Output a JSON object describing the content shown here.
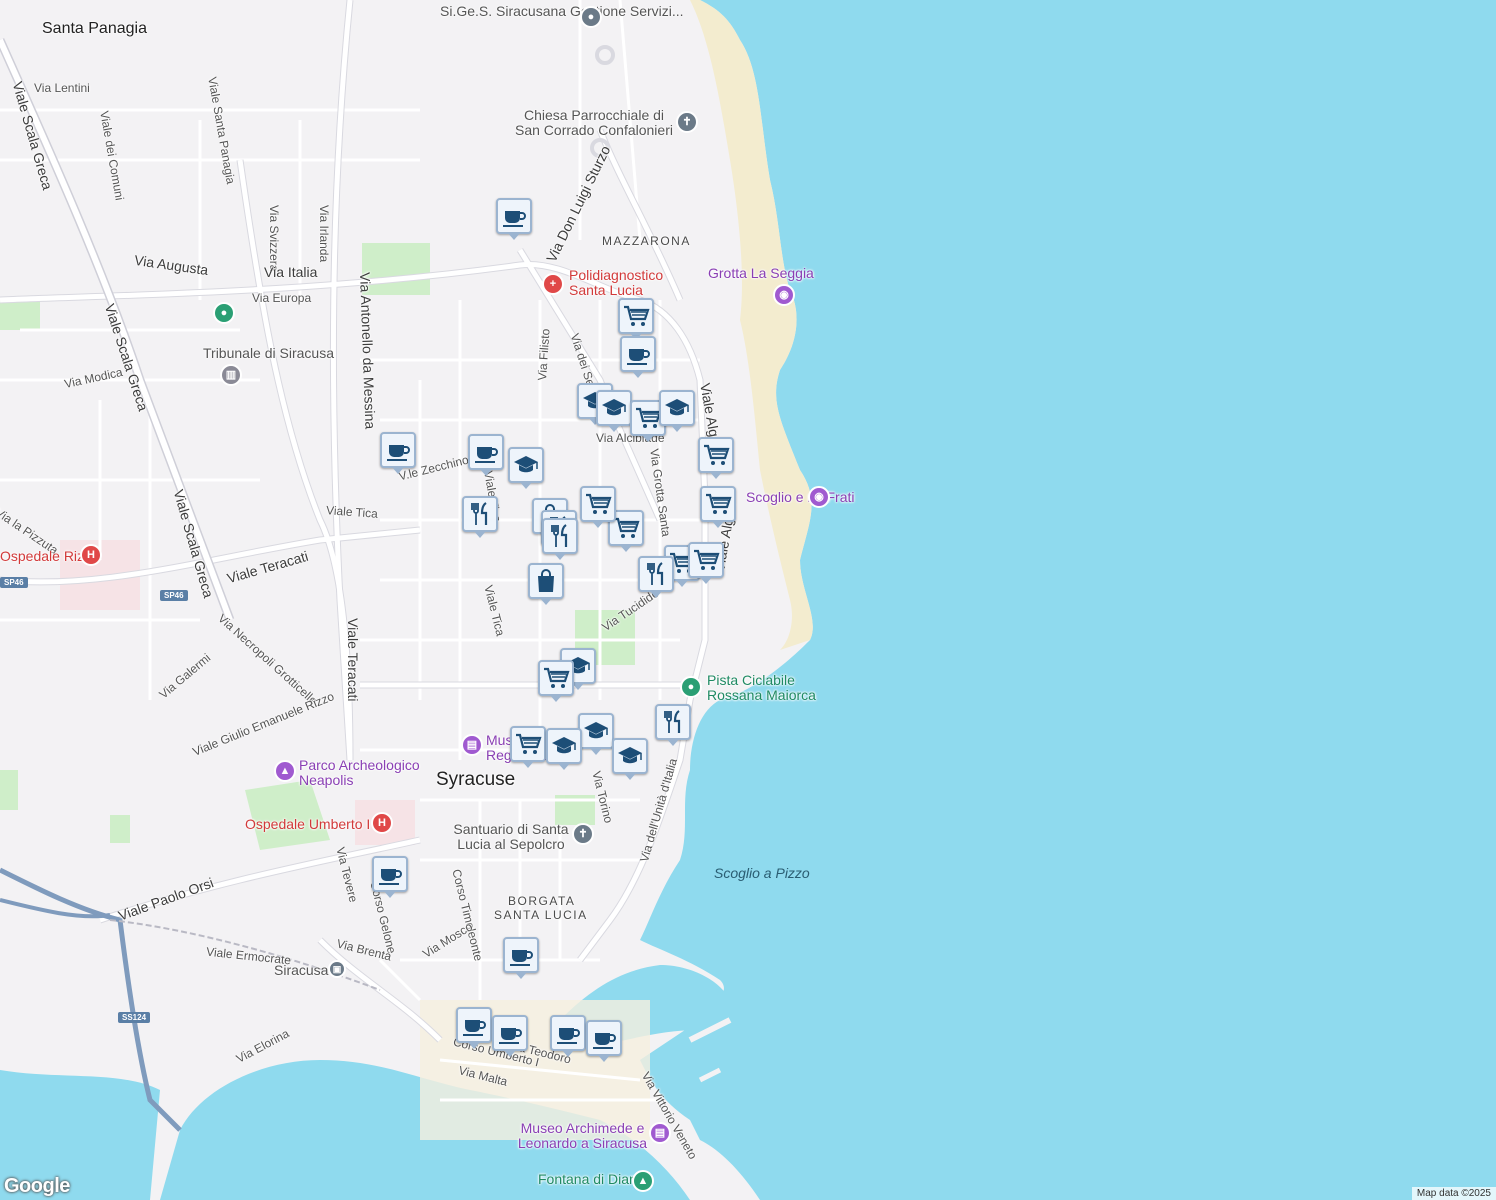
{
  "map": {
    "attribution": "Map data ©2025",
    "logo_text": "Google",
    "colors": {
      "sea": "#8fdaee",
      "land": "#f3f2f4",
      "park": "#cfeec9",
      "beach": "#f3eccf",
      "road": "#ffffff",
      "highway": "#7f9bbd",
      "marker_icon": "#1d4e77"
    },
    "places": {
      "city": "Syracuse",
      "neighborhoods": [
        "Santa Panagia",
        "MAZZARONA",
        "BORGATA",
        "SANTA LUCIA"
      ],
      "water_label": "Scoglio a Pizzo"
    },
    "roads": [
      "Via Lentini",
      "Viale dei Comuni",
      "Viale Santa Panagia",
      "Viale Scala Greca",
      "Via Svizzera",
      "Via Irlanda",
      "Via Italia",
      "Via Augusta",
      "Via Europa",
      "Via Antonello da Messina",
      "Via Don Luigi Sturzo",
      "Via dei Servi",
      "Via Filisto",
      "Via Alcibiade",
      "Via Grotta Santa",
      "Viale Algeri",
      "Via Modica",
      "V.le Zecchino",
      "Viale Tica",
      "Viale Teracati",
      "Via Tucidide",
      "Via Necropoli Grotticelle",
      "Via Galermi",
      "Viale Giulio Emanuele Rizzo",
      "Via Torino",
      "Via dell'Unità d'Italia",
      "Via Tevere",
      "Corso Gelone",
      "Corso Timoleonte",
      "Via Mosco",
      "Via Brenta",
      "Viale Ermocrate",
      "Viale Paolo Orsi",
      "Via Elorina",
      "Corso Umberto I",
      "Via Malta",
      "Via Vittorio Veneto",
      "Via la Pizzuta",
      "Via Teodoro"
    ],
    "shields": [
      "SP46",
      "SS124",
      "SP46"
    ],
    "pois": [
      {
        "name": "Si.Ge.S. Siracusana Gestione Servizi...",
        "type": "service",
        "icon": "circle-dot-icon"
      },
      {
        "name": "Chiesa Parrocchiale di San Corrado Confalonieri",
        "type": "church",
        "icon": "cross-icon"
      },
      {
        "name": "Polidiagnostico Santa Lucia",
        "type": "medical",
        "icon": "medical-plus-icon"
      },
      {
        "name": "Grotta La Seggia",
        "type": "attraction",
        "icon": "camera-icon"
      },
      {
        "name": "Tribunale di Siracusa",
        "type": "government",
        "icon": "building-icon"
      },
      {
        "name": "Scoglio e ru' Frati",
        "type": "attraction",
        "icon": "camera-icon"
      },
      {
        "name": "Ospedale Rizza",
        "type": "hospital",
        "icon": "hospital-icon"
      },
      {
        "name": "Pista Ciclabile Rossana Maiorca",
        "type": "park",
        "icon": "circle-dot-icon"
      },
      {
        "name": "Museo Regionale",
        "type": "museum",
        "icon": "museum-icon"
      },
      {
        "name": "Parco Archeologico Neapolis",
        "type": "park",
        "icon": "park-icon"
      },
      {
        "name": "Ospedale Umberto I",
        "type": "hospital",
        "icon": "hospital-icon"
      },
      {
        "name": "Santuario di Santa Lucia al Sepolcro",
        "type": "church",
        "icon": "cross-icon"
      },
      {
        "name": "Siracusa",
        "type": "train-station",
        "icon": "train-icon"
      },
      {
        "name": "Museo Archimede e Leonardo a Siracusa",
        "type": "museum",
        "icon": "museum-icon"
      },
      {
        "name": "Fontana di Diana",
        "type": "monument",
        "icon": "park-icon"
      }
    ],
    "markers": [
      {
        "icon": "coffee-icon"
      },
      {
        "icon": "cart-icon"
      },
      {
        "icon": "coffee-icon"
      },
      {
        "icon": "school-icon"
      },
      {
        "icon": "school-icon"
      },
      {
        "icon": "cart-icon"
      },
      {
        "icon": "school-icon"
      },
      {
        "icon": "coffee-icon"
      },
      {
        "icon": "school-icon"
      },
      {
        "icon": "coffee-icon"
      },
      {
        "icon": "restaurant-icon"
      },
      {
        "icon": "cart-icon"
      },
      {
        "icon": "cart-icon"
      },
      {
        "icon": "cart-icon"
      },
      {
        "icon": "shopping-bag-icon"
      },
      {
        "icon": "restaurant-icon"
      },
      {
        "icon": "cart-icon"
      },
      {
        "icon": "restaurant-icon"
      },
      {
        "icon": "shopping-bag-icon"
      },
      {
        "icon": "cart-icon"
      },
      {
        "icon": "cart-icon"
      },
      {
        "icon": "restaurant-icon"
      },
      {
        "icon": "school-icon"
      },
      {
        "icon": "cart-icon"
      },
      {
        "icon": "cart-icon"
      },
      {
        "icon": "school-icon"
      },
      {
        "icon": "school-icon"
      },
      {
        "icon": "school-icon"
      },
      {
        "icon": "restaurant-icon"
      },
      {
        "icon": "coffee-icon"
      },
      {
        "icon": "coffee-icon"
      },
      {
        "icon": "coffee-icon"
      },
      {
        "icon": "coffee-icon"
      },
      {
        "icon": "coffee-icon"
      },
      {
        "icon": "coffee-icon"
      }
    ]
  }
}
